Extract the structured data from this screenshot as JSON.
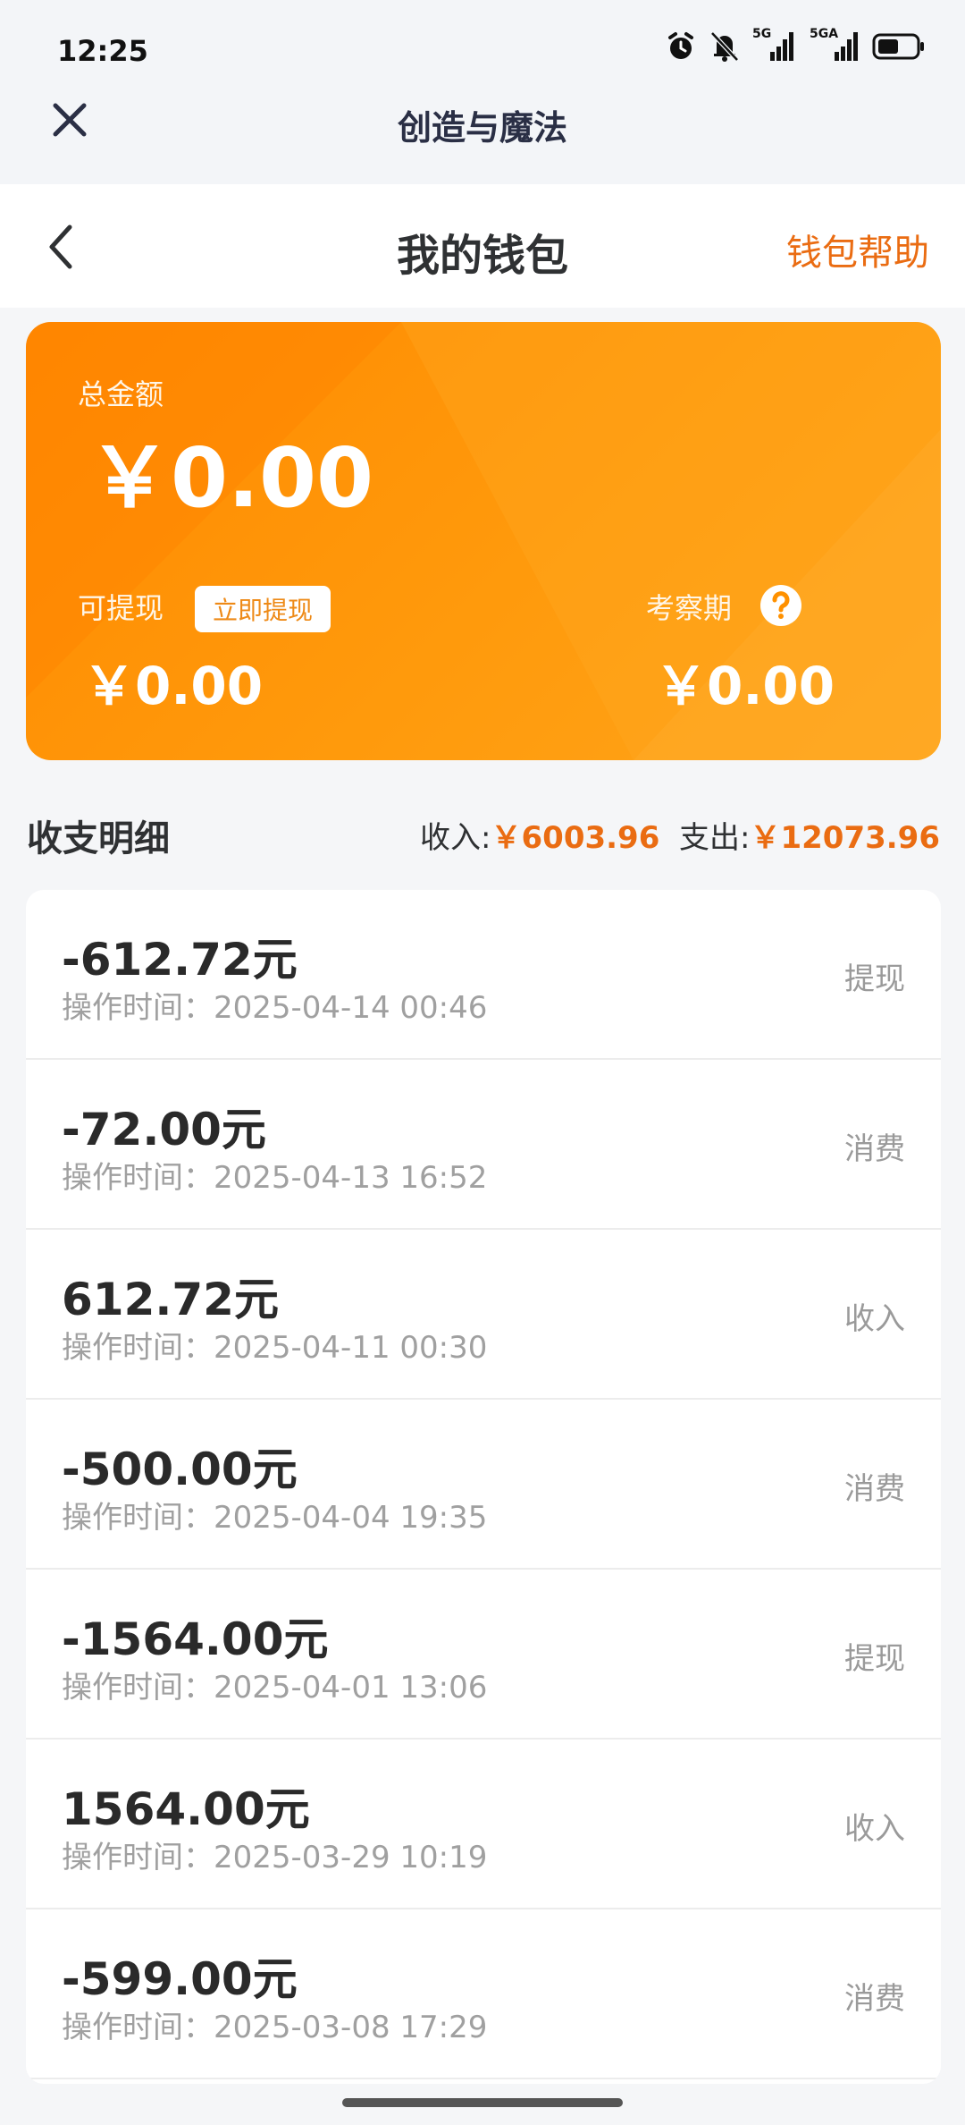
{
  "status": {
    "time": "12:25",
    "icons": [
      "alarm-icon",
      "bell-muted-icon",
      "signal-5g-icon",
      "signal-5ga-icon",
      "battery-icon"
    ],
    "signal_labels": [
      "5G",
      "5GA"
    ]
  },
  "mini_header": {
    "title": "创造与魔法"
  },
  "page_header": {
    "title": "我的钱包",
    "help_label": "钱包帮助"
  },
  "wallet_card": {
    "total_label": "总金额",
    "total_amount": "￥0.00",
    "withdrawable_label": "可提现",
    "withdraw_button": "立即提现",
    "withdrawable_amount": "￥0.00",
    "review_label": "考察期",
    "review_amount": "￥0.00"
  },
  "summary": {
    "title": "收支明细",
    "income_label": "收入:",
    "income_amount": "￥6003.96",
    "expense_label": "支出:",
    "expense_amount": "￥12073.96"
  },
  "transactions": [
    {
      "amount": "-612.72元",
      "time": "操作时间：2025-04-14 00:46",
      "type": "提现"
    },
    {
      "amount": "-72.00元",
      "time": "操作时间：2025-04-13 16:52",
      "type": "消费"
    },
    {
      "amount": "612.72元",
      "time": "操作时间：2025-04-11 00:30",
      "type": "收入"
    },
    {
      "amount": "-500.00元",
      "time": "操作时间：2025-04-04 19:35",
      "type": "消费"
    },
    {
      "amount": "-1564.00元",
      "time": "操作时间：2025-04-01 13:06",
      "type": "提现"
    },
    {
      "amount": "1564.00元",
      "time": "操作时间：2025-03-29 10:19",
      "type": "收入"
    },
    {
      "amount": "-599.00元",
      "time": "操作时间：2025-03-08 17:29",
      "type": "消费"
    }
  ],
  "colors": {
    "accent": "#ea6c12",
    "card_start": "#ff8a00",
    "card_end": "#ffa51a",
    "background": "#f5f6f8"
  }
}
